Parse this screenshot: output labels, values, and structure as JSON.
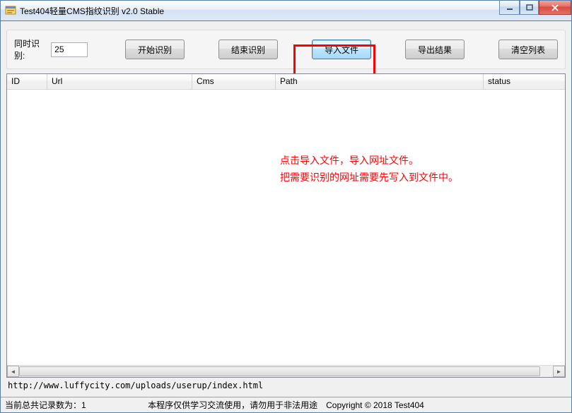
{
  "window": {
    "title": "Test404轻量CMS指纹识别 v2.0 Stable"
  },
  "toolbar": {
    "concurrent_label": "同时识别:",
    "concurrent_value": "25",
    "start_label": "开始识别",
    "stop_label": "结束识别",
    "import_label": "导入文件",
    "export_label": "导出结果",
    "clear_label": "清空列表"
  },
  "columns": {
    "id": "ID",
    "url": "Url",
    "cms": "Cms",
    "path": "Path",
    "status": "status"
  },
  "annotation": {
    "line1": "点击导入文件，导入网址文件。",
    "line2": "把需要识别的网址需要先写入到文件中。"
  },
  "url_text": "http://www.luffycity.com/uploads/userup/index.html",
  "status": {
    "left": "当前总共记录数为：1",
    "mid": "本程序仅供学习交流使用，请勿用于非法用途　Copyright © 2018 Test404"
  }
}
